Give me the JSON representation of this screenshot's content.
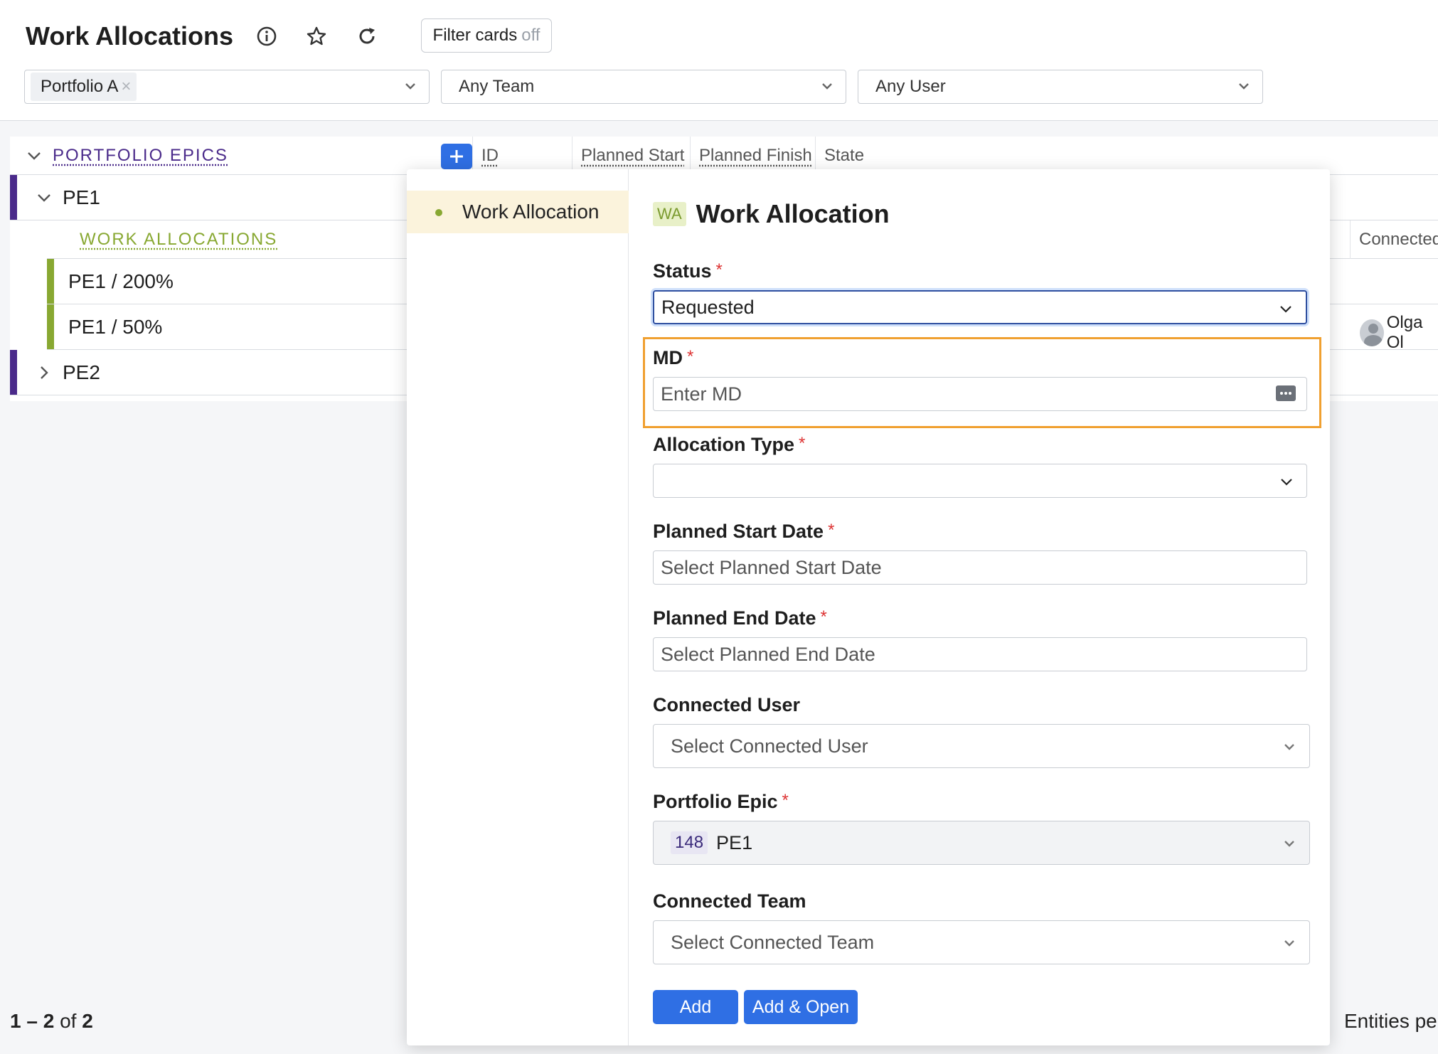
{
  "header": {
    "title": "Work Allocations",
    "filter_cards_label": "Filter cards",
    "filter_cards_state": "off",
    "portfolio_chip": "Portfolio A",
    "team_select": "Any Team",
    "user_select": "Any User"
  },
  "grid": {
    "section_label": "PORTFOLIO EPICS",
    "columns": [
      "ID",
      "Planned Start",
      "Planned Finish",
      "State"
    ],
    "rows": [
      {
        "label": "PE1"
      },
      {
        "label": "PE2"
      }
    ],
    "sub_section_label": "WORK ALLOCATIONS",
    "sub_rows": [
      {
        "label": "PE1 / 200%"
      },
      {
        "label": "PE1 / 50%"
      }
    ],
    "right_col_header": "Connected",
    "right_col_user": "Olga Ol"
  },
  "footer": {
    "range": "1 – 2",
    "of_label": "of",
    "total": "2",
    "per_page_label": "Entities per"
  },
  "popup": {
    "side_item": "Work Allocation",
    "badge": "WA",
    "title": "Work Allocation",
    "fields": {
      "status_label": "Status",
      "status_value": "Requested",
      "md_label": "MD",
      "md_placeholder": "Enter MD",
      "allocation_type_label": "Allocation Type",
      "planned_start_label": "Planned Start Date",
      "planned_start_placeholder": "Select Planned Start Date",
      "planned_end_label": "Planned End Date",
      "planned_end_placeholder": "Select Planned End Date",
      "connected_user_label": "Connected User",
      "connected_user_placeholder": "Select Connected User",
      "portfolio_epic_label": "Portfolio Epic",
      "portfolio_epic_id": "148",
      "portfolio_epic_value": "PE1",
      "connected_team_label": "Connected Team",
      "connected_team_placeholder": "Select Connected Team"
    },
    "required_mark": "*",
    "add_label": "Add",
    "add_open_label": "Add & Open"
  },
  "colors": {
    "accent_blue": "#2f6fe4",
    "epic_purple": "#4a2a8a",
    "allocation_green": "#88a832",
    "highlight_orange": "#f0a030",
    "required_red": "#dd3333"
  }
}
